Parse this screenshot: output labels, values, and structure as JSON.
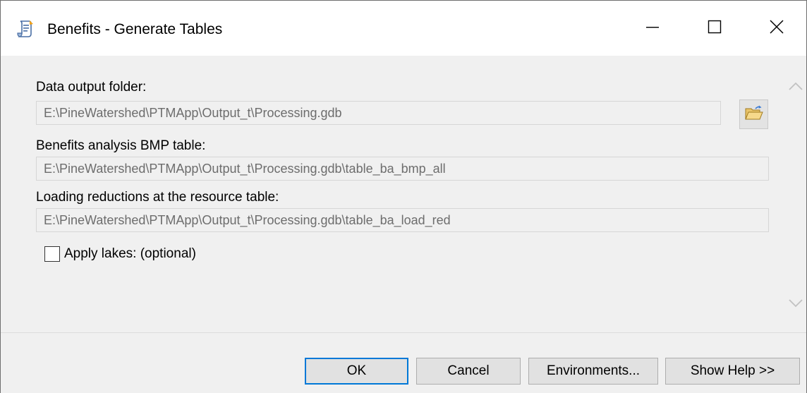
{
  "window": {
    "title": "Benefits - Generate Tables",
    "app_icon": "script-tool-icon",
    "controls": {
      "minimize": "minimize-icon",
      "maximize": "maximize-icon",
      "close": "close-icon"
    }
  },
  "form": {
    "output_folder": {
      "label": "Data output folder:",
      "value": "E:\\PineWatershed\\PTMApp\\Output_t\\Processing.gdb",
      "browse_icon": "open-folder-icon"
    },
    "bmp_table": {
      "label": "Benefits analysis BMP table:",
      "value": "E:\\PineWatershed\\PTMApp\\Output_t\\Processing.gdb\\table_ba_bmp_all"
    },
    "loading_table": {
      "label": "Loading reductions at the resource table:",
      "value": "E:\\PineWatershed\\PTMApp\\Output_t\\Processing.gdb\\table_ba_load_red"
    },
    "apply_lakes": {
      "label": "Apply lakes: (optional)",
      "checked": false
    }
  },
  "footer": {
    "ok_label": "OK",
    "cancel_label": "Cancel",
    "environments_label": "Environments...",
    "help_label": "Show Help >>"
  },
  "colors": {
    "accent": "#0078d7",
    "dialog_bg": "#f0f0f0",
    "disabled_text": "#6d6d6d"
  }
}
